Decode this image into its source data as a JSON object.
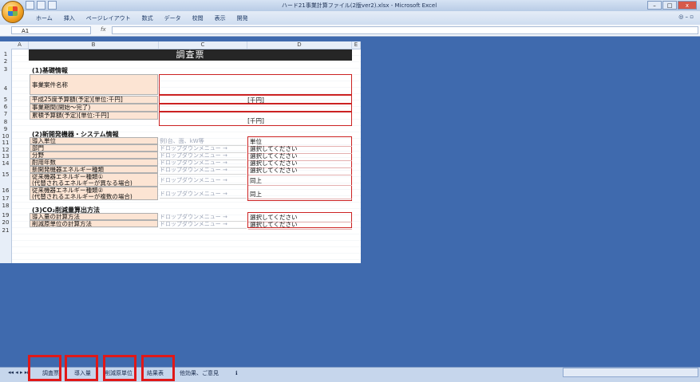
{
  "window": {
    "title": "ハード21事業計算ファイル(2版ver2).xlsx - Microsoft Excel",
    "minimize": "–",
    "maximize": "□",
    "close": "x"
  },
  "ribbon": {
    "tabs": [
      "ホーム",
      "挿入",
      "ページレイアウト",
      "数式",
      "データ",
      "校閲",
      "表示",
      "開発"
    ],
    "right": "◎ – ▫"
  },
  "formula_bar": {
    "name_box": "A1",
    "fx": "fx",
    "value": ""
  },
  "sheet": {
    "columns": [
      "A",
      "B",
      "C",
      "D",
      "E"
    ],
    "rows": [
      "1",
      "2",
      "3",
      "4",
      "5",
      "6",
      "7",
      "8",
      "9",
      "10",
      "11",
      "12",
      "13",
      "14",
      "15",
      "16",
      "17",
      "18",
      "19",
      "20",
      "21"
    ],
    "title": "調査票",
    "section1": "(1)基礎情報",
    "section2": "(2)新開発機器・システム情報",
    "section3": "(3)CO₂削減量算出方法",
    "basic": {
      "project_name": "事業案件名称",
      "budget": "平成25度予算額(予定)[単位:千円]",
      "period": "事業期間(開始〜完了)",
      "total_budget": "累積予算額(予定)[単位:千円]",
      "unit_thousand": "[千円]"
    },
    "system": {
      "unit_label": "導入単位",
      "unit_hint": "例)台、面、kW等",
      "unit_value": "単位",
      "sector": "部門",
      "field": "分野",
      "durable_years": "耐用年数",
      "new_energy": "新開発機器エネルギー種類",
      "old_energy1": "従来機器エネルギー種類①",
      "old_energy1_note": "(代替されるエネルギーが異なる場合)",
      "old_energy2": "従来機器エネルギー種類②",
      "old_energy2_note": "(代替されるエネルギーが複数の場合)",
      "dropdown": "ドロップダウンメニュー →",
      "select": "選択してください",
      "same": "同上"
    },
    "method": {
      "install_calc": "導入量の計算方法",
      "reduction_calc": "削減原単位の計算方法"
    }
  },
  "sheet_tabs": [
    "調査票",
    "導入量",
    "削減原単位",
    "結果表",
    "他効果、ご意見",
    "ℹ"
  ],
  "nav_arrows": "◂◂ ◂ ▸ ▸▸"
}
